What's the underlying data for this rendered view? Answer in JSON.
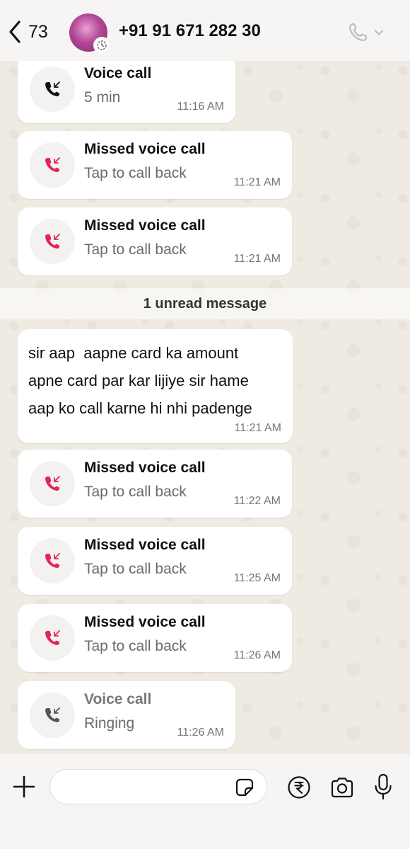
{
  "header": {
    "back_count": "73",
    "contact_name": "+91 91 671 282 30"
  },
  "messages": [
    {
      "kind": "call",
      "title": "Voice call",
      "subtitle": "5 min",
      "time": "11:16 AM",
      "status": "incoming"
    },
    {
      "kind": "call",
      "title": "Missed voice call",
      "subtitle": "Tap to call back",
      "time": "11:21 AM",
      "status": "missed"
    },
    {
      "kind": "call",
      "title": "Missed voice call",
      "subtitle": "Tap to call back",
      "time": "11:21 AM",
      "status": "missed"
    },
    {
      "kind": "divider",
      "text": "1 unread message"
    },
    {
      "kind": "text",
      "text": "sir aap  aapne card ka amount\napne card par kar lijiye sir hame\naap ko call karne hi nhi padenge",
      "time": "11:21 AM"
    },
    {
      "kind": "call",
      "title": "Missed voice call",
      "subtitle": "Tap to call back",
      "time": "11:22 AM",
      "status": "missed"
    },
    {
      "kind": "call",
      "title": "Missed voice call",
      "subtitle": "Tap to call back",
      "time": "11:25 AM",
      "status": "missed"
    },
    {
      "kind": "call",
      "title": "Missed voice call",
      "subtitle": "Tap to call back",
      "time": "11:26 AM",
      "status": "missed"
    },
    {
      "kind": "call",
      "title": "Voice call",
      "subtitle": "Ringing",
      "time": "11:26 AM",
      "status": "ringing"
    }
  ],
  "composer": {
    "value": ""
  },
  "colors": {
    "missed": "#e0245e",
    "incoming": "#111111",
    "ringing": "#555555",
    "background": "#efeae2",
    "bubble": "#ffffff"
  },
  "icons": [
    "back-chevron-icon",
    "status-ring-icon",
    "phone-icon",
    "chevron-down-icon",
    "incoming-call-icon",
    "missed-call-icon",
    "plus-icon",
    "sticker-icon",
    "rupee-payment-icon",
    "camera-icon",
    "microphone-icon"
  ]
}
